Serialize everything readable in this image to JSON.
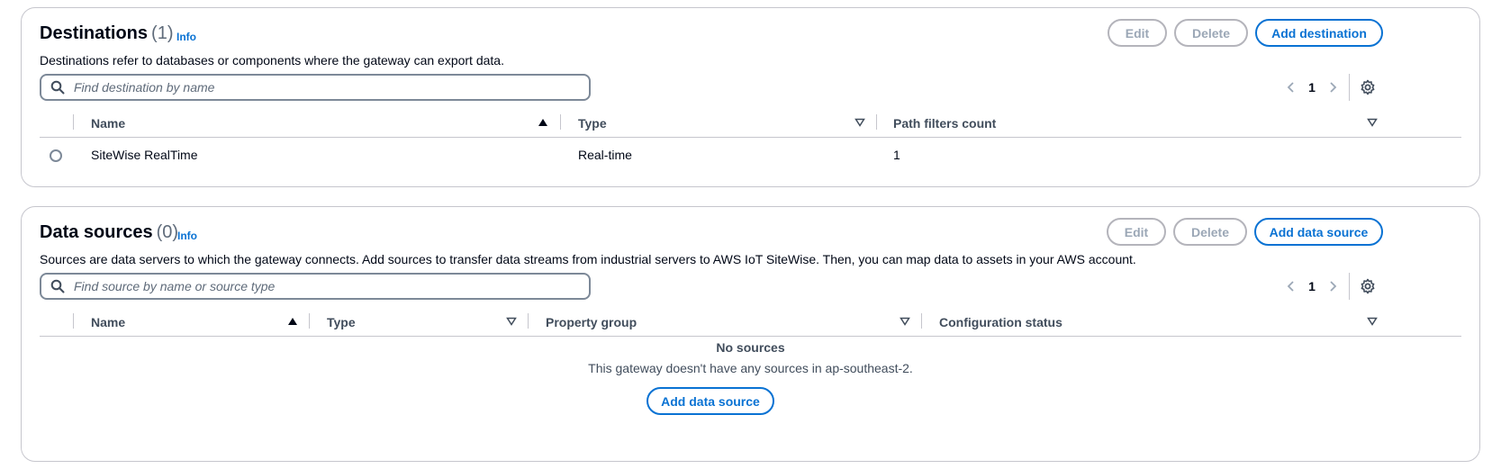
{
  "destinations": {
    "title": "Destinations",
    "count": "(1)",
    "info": "Info",
    "description": "Destinations refer to databases or components where the gateway can export data.",
    "buttons": {
      "edit": "Edit",
      "delete": "Delete",
      "add": "Add destination"
    },
    "search": {
      "placeholder": "Find destination by name",
      "icon": "search-icon"
    },
    "pagination": {
      "page": "1"
    },
    "columns": [
      "Name",
      "Type",
      "Path filters count"
    ],
    "rows": [
      {
        "name": "SiteWise RealTime",
        "type": "Real-time",
        "path_filters_count": "1",
        "selected": false
      }
    ]
  },
  "data_sources": {
    "title": "Data sources",
    "count": "(0)",
    "info": "Info",
    "description": "Sources are data servers to which the gateway connects. Add sources to transfer data streams from industrial servers to AWS IoT SiteWise. Then, you can map data to assets in your AWS account.",
    "buttons": {
      "edit": "Edit",
      "delete": "Delete",
      "add": "Add data source"
    },
    "search": {
      "placeholder": "Find source by name or source type",
      "icon": "search-icon"
    },
    "pagination": {
      "page": "1"
    },
    "columns": [
      "Name",
      "Type",
      "Property group",
      "Configuration status"
    ],
    "empty": {
      "title": "No sources",
      "description": "This gateway doesn't have any sources in ap-southeast-2.",
      "button": "Add data source"
    }
  },
  "colors": {
    "accent": "#0972d3",
    "text": "#000716",
    "muted": "#414d5c",
    "border": "#c6c6cd",
    "disabled": "#9ba7b6"
  }
}
